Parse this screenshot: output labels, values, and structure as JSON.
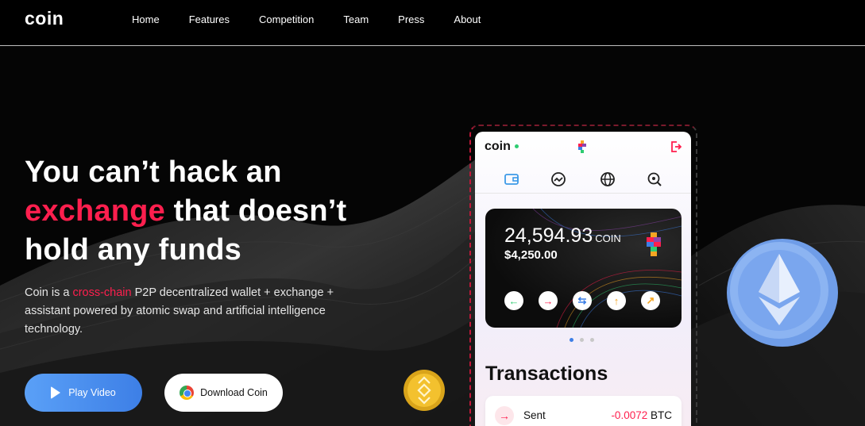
{
  "header": {
    "logo": "coin",
    "nav": [
      "Home",
      "Features",
      "Competition",
      "Team",
      "Press",
      "About"
    ]
  },
  "hero": {
    "line1": "You can’t hack an",
    "line2_accent": "exchange",
    "line2_rest": " that doesn’t",
    "line3": "hold any funds",
    "sub_prefix": "Coin is a ",
    "sub_accent": "cross-chain",
    "sub_rest": " P2P decentralized wallet + exchange + assistant powered by atomic swap and artificial intelligence technology."
  },
  "buttons": {
    "play": "Play Video",
    "download": "Download Coin"
  },
  "phone": {
    "app_name": "coin",
    "tabs": [
      "wallet-icon",
      "chart-icon",
      "globe-icon",
      "search-coin-icon"
    ],
    "balance": {
      "amount": "24,594.93",
      "unit": "COIN",
      "usd": "$4,250.00"
    },
    "actions": [
      {
        "glyph": "←",
        "color": "#2ecc71"
      },
      {
        "glyph": "→",
        "color": "#ff1f4e"
      },
      {
        "glyph": "⇆",
        "color": "#3d7fe6"
      },
      {
        "glyph": "↑",
        "color": "#f5a623"
      },
      {
        "glyph": "↗",
        "color": "#f5a623"
      }
    ],
    "transactions_title": "Transactions",
    "transaction": {
      "label": "Sent",
      "value": "-0.0072",
      "unit": "BTC"
    }
  },
  "colors": {
    "accent": "#ff1f4e",
    "play_button": "#4a8ff0",
    "background": "#000000"
  }
}
